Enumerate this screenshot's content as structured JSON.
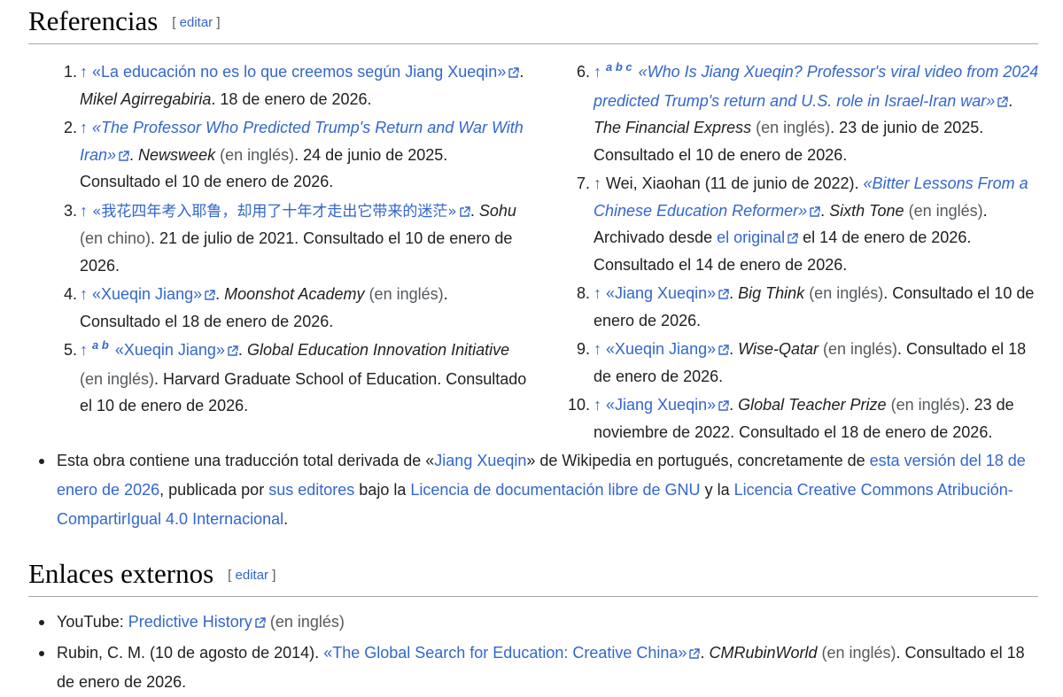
{
  "refs_heading": "Referencias",
  "edit": {
    "open": "[",
    "label": "editar",
    "close": "]"
  },
  "references_left": [
    {
      "num": "1.",
      "arrow": "↑",
      "title": "«La educación no es lo que creemos según Jiang Xueqin»",
      "pub": "Mikel Agirregabiria",
      "lang": "",
      "rest": ". 18 de enero de 2026."
    },
    {
      "num": "2.",
      "arrow": "↑",
      "title": "«The Professor Who Predicted Trump's Return and War With Iran»",
      "pub": "Newsweek",
      "lang": "(en inglés)",
      "rest": ". 24 de junio de 2025. Consultado el 10 de enero de 2026."
    },
    {
      "num": "3.",
      "arrow": "↑",
      "title": "«我花四年考入耶鲁，却用了十年才走出它带来的迷茫»",
      "pub": "Sohu",
      "lang": "(en chino)",
      "rest": ". 21 de julio de 2021. Consultado el 10 de enero de 2026."
    },
    {
      "num": "4.",
      "arrow": "↑",
      "title": "«Xueqin Jiang»",
      "pub": "Moonshot Academy",
      "lang": "(en inglés)",
      "rest": ". Consultado el 18 de enero de 2026."
    },
    {
      "num": "5.",
      "arrow": "↑",
      "backrefs": "a b",
      "title": "«Xueqin Jiang»",
      "pub": "Global Education Innovation Initiative",
      "lang": "(en inglés)",
      "rest": ". Harvard Graduate School of Education. Consultado el 10 de enero de 2026."
    }
  ],
  "references_right": [
    {
      "num": "6.",
      "arrow": "↑",
      "backrefs": "a b c",
      "title": "«Who Is Jiang Xueqin? Professor's viral video from 2024 predicted Trump's return and U.S. role in Israel-Iran war»",
      "pub": "The Financial Express",
      "lang": "(en inglés)",
      "rest": ". 23 de junio de 2025. Consultado el 10 de enero de 2026."
    },
    {
      "num": "7.",
      "arrow": "↑",
      "author": "Wei, Xiaohan (11 de junio de 2022).",
      "title": "«Bitter Lessons From a Chinese Education Reformer»",
      "pub": "Sixth Tone",
      "lang": "(en inglés)",
      "archived_prefix": ". Archivado desde",
      "archived_link": "el original",
      "rest": "el 14 de enero de 2026. Consultado el 14 de enero de 2026."
    },
    {
      "num": "8.",
      "arrow": "↑",
      "title": "«Jiang Xueqin»",
      "pub": "Big Think",
      "lang": "(en inglés)",
      "rest": ". Consultado el 10 de enero de 2026."
    },
    {
      "num": "9.",
      "arrow": "↑",
      "title": "«Xueqin Jiang»",
      "pub": "Wise-Qatar",
      "lang": "(en inglés)",
      "rest": ". Consultado el 18 de enero de 2026."
    },
    {
      "num": "10.",
      "arrow": "↑",
      "title": "«Jiang Xueqin»",
      "pub": "Global Teacher Prize",
      "lang": "(en inglés)",
      "rest": ". 23 de noviembre de 2022. Consultado el 18 de enero de 2026."
    }
  ],
  "translation_note": {
    "t1": "Esta obra contiene una traducción total derivada de «",
    "l1": "Jiang Xueqin",
    "t2": "» de Wikipedia en portugués, concretamente de",
    "l2": "esta versión del 18 de enero de 2026",
    "t3": ", publicada por",
    "l3": "sus editores",
    "t4": "bajo la",
    "l4": "Licencia de documentación libre de GNU",
    "t5": "y la",
    "l5": "Licencia Creative Commons Atribución-CompartirIgual 4.0 Internacional",
    "t6": "."
  },
  "external_heading": "Enlaces externos",
  "external_links": [
    {
      "prefix": "YouTube:",
      "link": "Predictive History",
      "lang": "(en inglés)"
    },
    {
      "prefix": "Rubin, C. M. (10 de agosto de 2014).",
      "link": "«The Global Search for Education: Creative China»",
      "pub": "CMRubinWorld",
      "lang": "(en inglés)",
      "rest": ". Consultado el 18 de enero de 2026."
    }
  ]
}
